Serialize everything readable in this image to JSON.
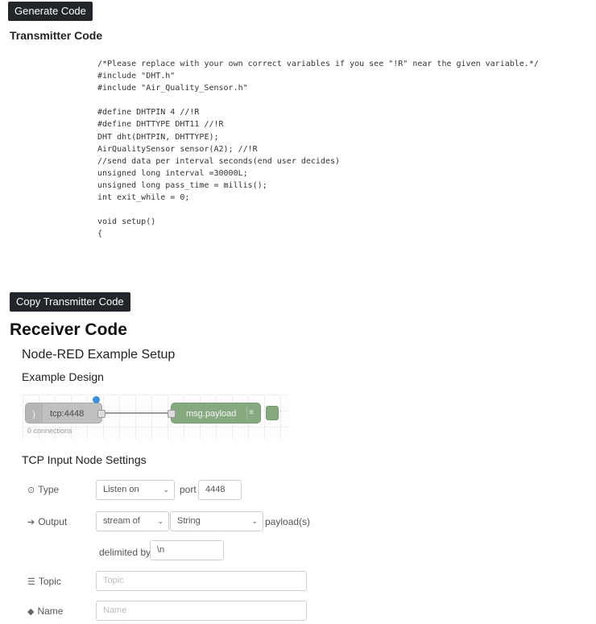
{
  "buttons": {
    "generate": "Generate Code",
    "copy_transmitter": "Copy Transmitter Code"
  },
  "transmitter": {
    "title": "Transmitter Code",
    "code": "/*Please replace with your own correct variables if you see \"!R\" near the given variable.*/\n#include \"DHT.h\"\n#include \"Air_Quality_Sensor.h\"\n\n#define DHTPIN 4 //!R\n#define DHTTYPE DHT11 //!R\nDHT dht(DHTPIN, DHTTYPE);\nAirQualitySensor sensor(A2); //!R\n//send data per interval seconds(end user decides)\nunsigned long interval =30000L;\nunsigned long pass_time = millis();\nint exit_while = 0;\n\nvoid setup()\n{"
  },
  "receiver": {
    "title": "Receiver Code",
    "subtitle": "Node-RED Example Setup",
    "example_design": "Example Design"
  },
  "flow": {
    "tcp_node": "tcp:4448",
    "debug_node": "msg.payload",
    "connections": "0 connections",
    "colors": {
      "tcp_node": "#c0c0c0",
      "debug_node": "#87a980",
      "status_dot": "#3b8fd9"
    }
  },
  "tcp_settings": {
    "title": "TCP Input Node Settings",
    "type_label": "Type",
    "type_value": "Listen on",
    "port_label": "port",
    "port_value": "4448",
    "output_label": "Output",
    "output_mode": "stream of",
    "output_type": "String",
    "payload_suffix": "payload(s)",
    "delimited_label": "delimited by",
    "delimiter_value": "\\n",
    "topic_label": "Topic",
    "topic_placeholder": "Topic",
    "name_label": "Name",
    "name_placeholder": "Name"
  },
  "icons": {
    "type": "radio-target-icon",
    "output": "sign-out-icon",
    "topic": "tasks-icon",
    "name": "tag-icon"
  }
}
